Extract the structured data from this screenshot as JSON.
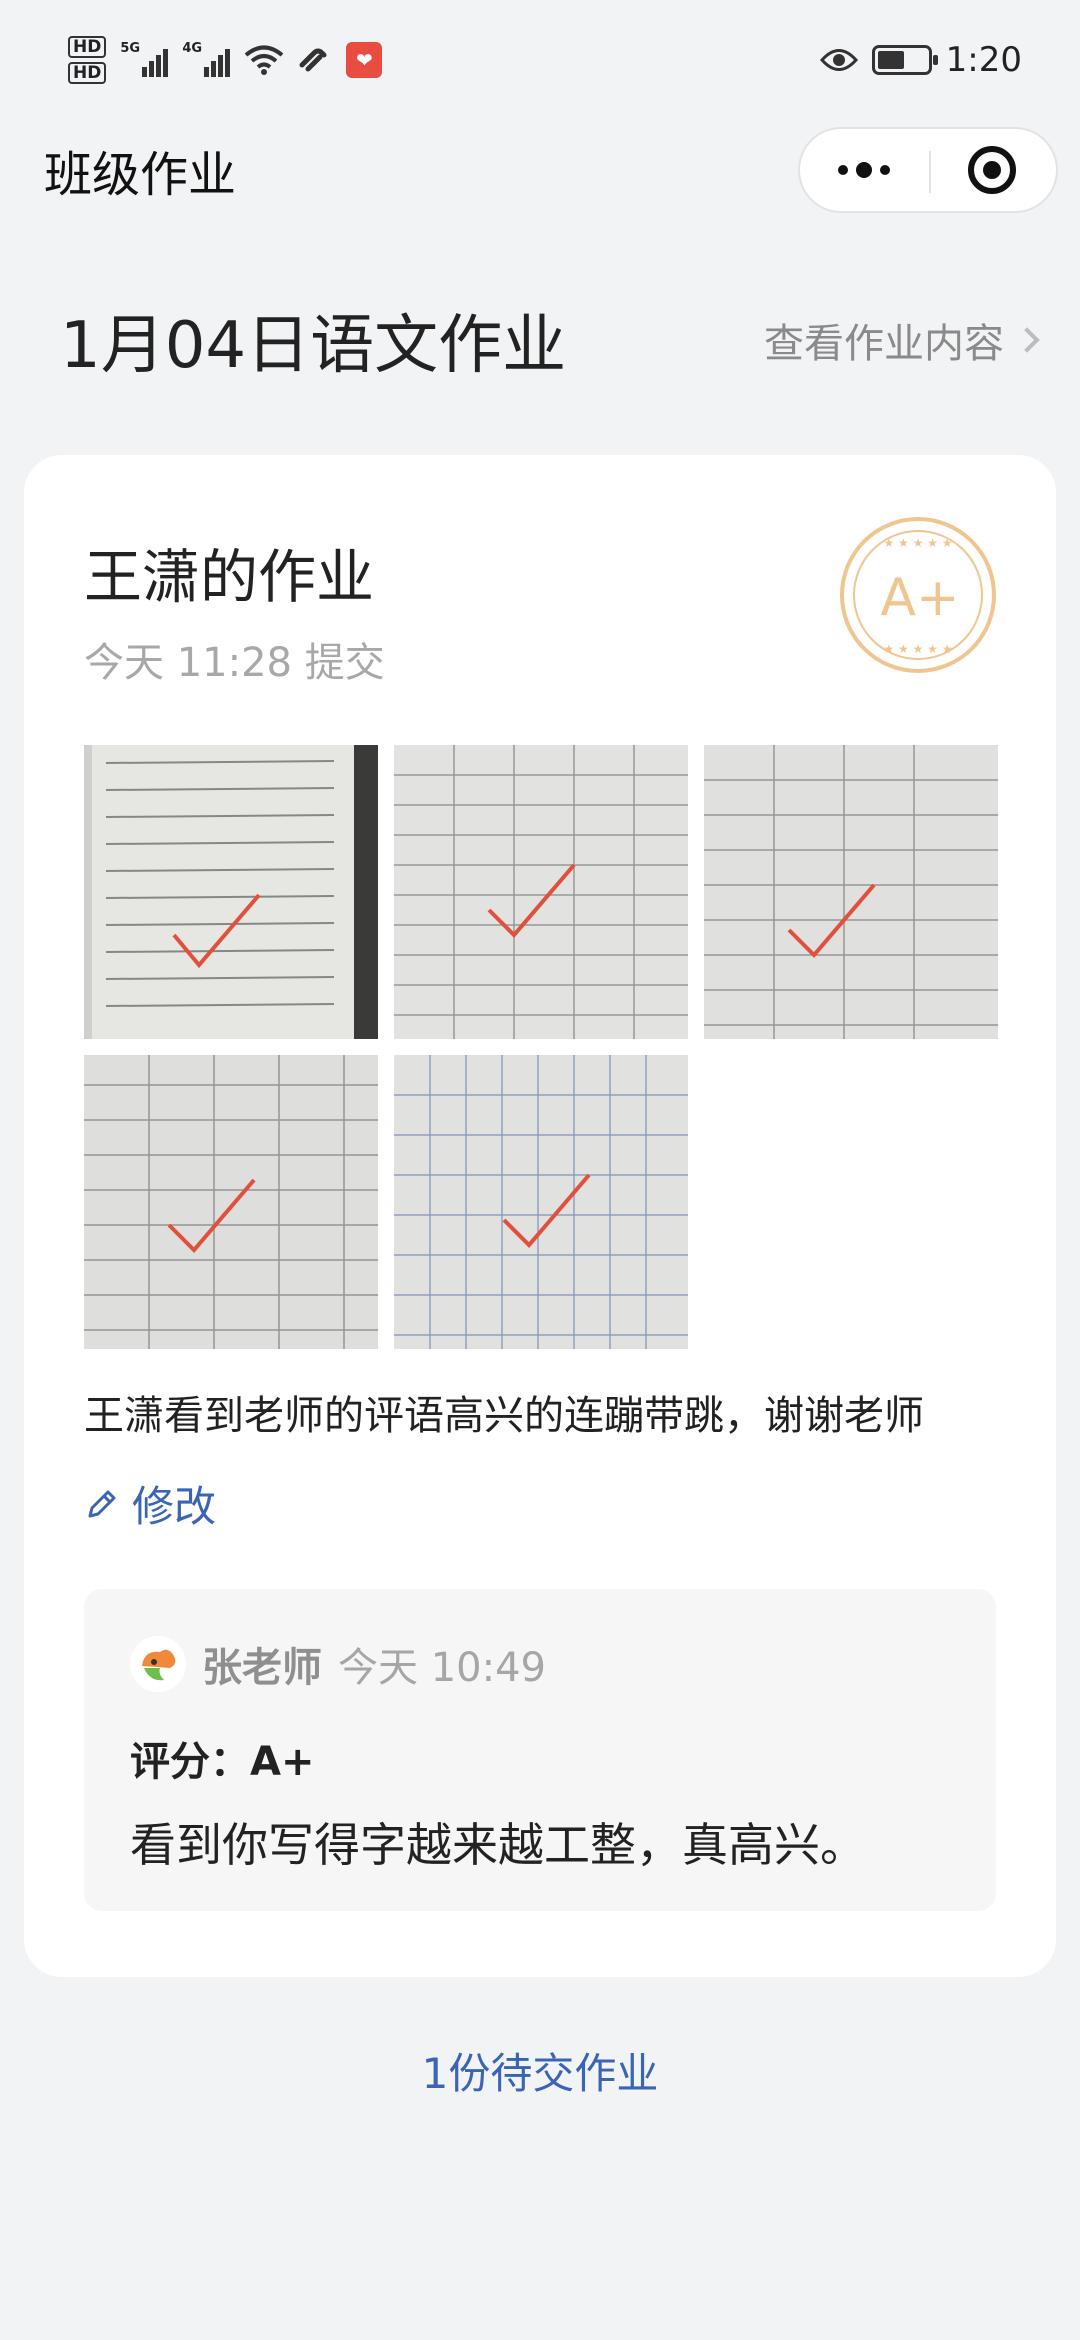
{
  "status_bar": {
    "hd1": "HD",
    "hd2": "HD",
    "sig1": "5G",
    "sig2": "4G",
    "time": "1:20"
  },
  "nav": {
    "title": "班级作业"
  },
  "header": {
    "title": "1月04日语文作业",
    "view_link": "查看作业内容"
  },
  "card": {
    "student_title": "王潇的作业",
    "submit_time": "今天 11:28 提交",
    "stamp_grade": "A+",
    "photo_count": 5,
    "comment": "王潇看到老师的评语高兴的连蹦带跳，谢谢老师",
    "edit_label": "修改"
  },
  "review": {
    "teacher": "张老师",
    "time": "今天 10:49",
    "score": "评分：A+",
    "comment": "看到你写得字越来越工整，真高兴。"
  },
  "footer": {
    "pending": "1份待交作业"
  },
  "colors": {
    "accent": "#3a64b6",
    "stamp": "#f0c58f",
    "check": "#e0503c"
  }
}
